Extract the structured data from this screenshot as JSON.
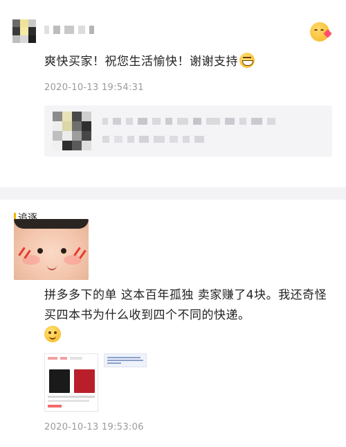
{
  "review1": {
    "text": "爽快买家！祝您生活愉快！谢谢支持",
    "timestamp": "2020-10-13 19:54:31",
    "icons": [
      "kiss-emoji-icon",
      "grin-emoji-icon"
    ]
  },
  "review2": {
    "username": "追逐",
    "text": "拼多多下的单 这本百年孤独 卖家赚了4块。我还奇怪买四本书为什么收到四个不同的快递。",
    "timestamp": "2020-10-13 19:53:06",
    "icons": [
      "smile-emoji-icon"
    ]
  },
  "colors": {
    "background": "#ffffff",
    "timestamp": "#9a9a9a",
    "divider": "#f3f3f6",
    "product_card": "#f4f4f7",
    "accent_yellow": "#f0b400"
  }
}
